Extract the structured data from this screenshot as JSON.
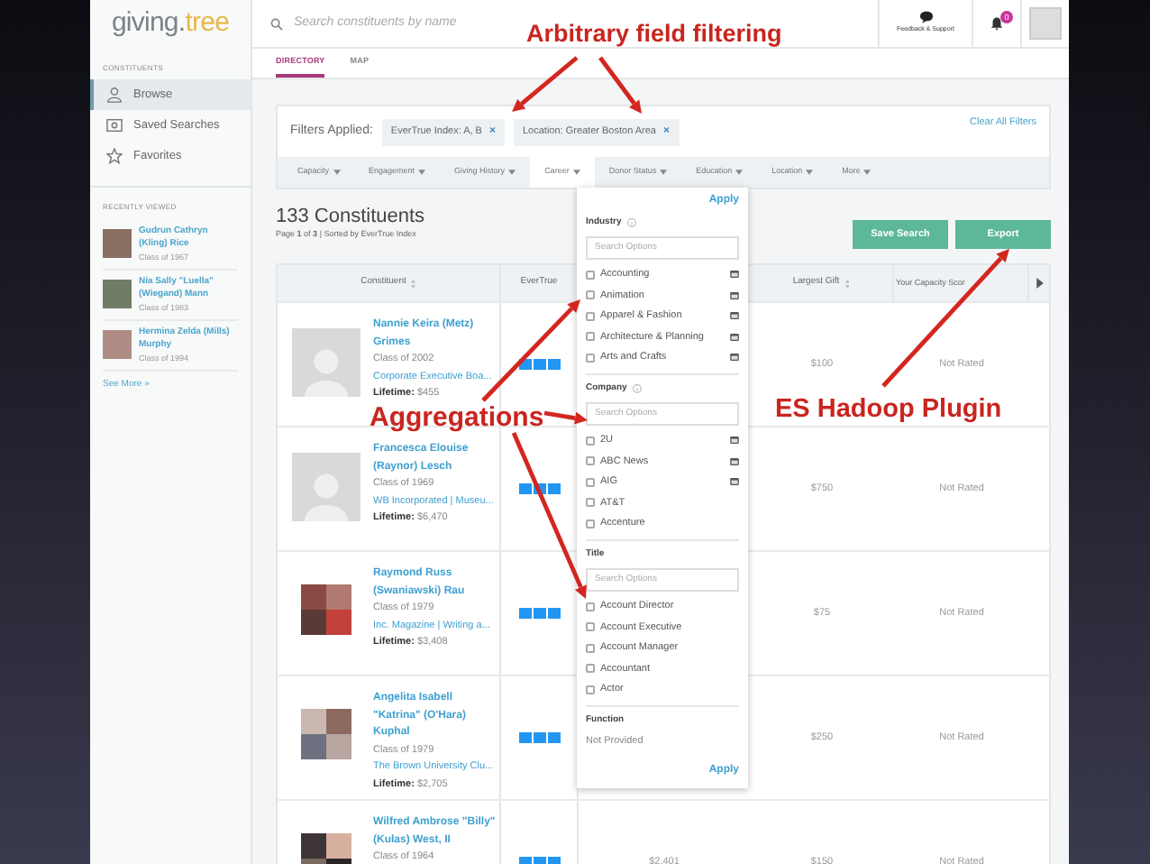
{
  "sidebar": {
    "logo": {
      "primary": "giving.",
      "accent": "tree"
    },
    "section_label": "CONSTITUENTS",
    "nav": [
      {
        "label": "Browse",
        "selected": true
      },
      {
        "label": "Saved Searches",
        "selected": false
      },
      {
        "label": "Favorites",
        "selected": false
      }
    ],
    "recent_label": "RECENTLY VIEWED",
    "recent": [
      {
        "name": "Gudrun Cathryn (Kling) Rice",
        "class_year": "Class of 1967"
      },
      {
        "name": "Nia Sally \"Luella\" (Wiegand) Mann",
        "class_year": "Class of 1983"
      },
      {
        "name": "Hermina Zelda (Mills) Murphy",
        "class_year": "Class of 1994"
      }
    ],
    "see_more": "See More »"
  },
  "header": {
    "search_placeholder": "Search constituents by name",
    "feedback": "Feedback & Support",
    "notifications": "0"
  },
  "tabs": [
    {
      "label": "DIRECTORY",
      "selected": true
    },
    {
      "label": "MAP",
      "selected": false
    }
  ],
  "filters": {
    "label": "Filters Applied:",
    "clear": "Clear All Filters",
    "chips": [
      {
        "label": "EverTrue Index: A, B",
        "remove": "×"
      },
      {
        "label": "Location: Greater Boston Area",
        "remove": "×"
      }
    ],
    "categories": [
      {
        "label": "Capacity",
        "selected": false
      },
      {
        "label": "Engagement",
        "selected": false
      },
      {
        "label": "Giving History",
        "selected": false
      },
      {
        "label": "Career",
        "selected": true
      },
      {
        "label": "Donor Status",
        "selected": false
      },
      {
        "label": "Education",
        "selected": false
      },
      {
        "label": "Location",
        "selected": false
      },
      {
        "label": "More",
        "selected": false
      }
    ]
  },
  "results": {
    "count": "133 Constituents",
    "subtitle": "Page **1** of **3** | Sorted by EverTrue Index",
    "buttons": [
      "Save Search",
      "Export"
    ]
  },
  "table": {
    "columns": [
      {
        "label": "Constituent",
        "sortable": true
      },
      {
        "label": "EverTrue",
        "sortable": false
      },
      {
        "label": "Largest Gift",
        "sortable": true
      },
      {
        "label": "Your Capacity Scor",
        "sortable": false
      }
    ],
    "rows": [
      {
        "kind": "avatar",
        "name": "Nannie Keira (Metz) Grimes",
        "class_year": "Class of 2002",
        "company": "Corporate Executive Boa...",
        "lifetime": "**Lifetime:** $455",
        "largest_gift": "$100",
        "capacity": "Not Rated"
      },
      {
        "kind": "avatar",
        "name": "Francesca Elouise (Raynor) Lesch",
        "class_year": "Class of 1969",
        "company": "WB Incorporated | Museu...",
        "lifetime": "**Lifetime:** $6,470",
        "largest_gift": "$750",
        "capacity": "Not Rated"
      },
      {
        "kind": "photo",
        "name": "Raymond Russ (Swaniawski) Rau",
        "class_year": "Class of 1979",
        "company": "Inc. Magazine | Writing a...",
        "lifetime": "**Lifetime:** $3,408",
        "largest_gift": "$75",
        "capacity": "Not Rated"
      },
      {
        "kind": "photo",
        "name": "Angelita Isabell \"Katrina\" (O'Hara) Kuphal",
        "class_year": "Class of 1979",
        "company": "The Brown University Clu...",
        "lifetime": "**Lifetime:** $2,705",
        "largest_gift": "$250",
        "capacity": "Not Rated"
      },
      {
        "kind": "photo",
        "name": "Wilfred Ambrose \"Billy\" (Kulas) West, II",
        "class_year": "Class of 1964",
        "column_3": "$2,401",
        "largest_gift": "$150",
        "capacity": "Not Rated"
      }
    ]
  },
  "dropdown": {
    "apply_top": "Apply",
    "apply_bottom": "Apply",
    "sections": [
      {
        "kind": "checklist",
        "title": "Industry",
        "info": true,
        "placeholder": "Search Options",
        "options": [
          {
            "label": "Accounting",
            "checked": false,
            "badge": true
          },
          {
            "label": "Animation",
            "checked": false,
            "badge": true
          },
          {
            "label": "Apparel & Fashion",
            "checked": false,
            "badge": true
          },
          {
            "label": "Architecture & Planning",
            "checked": false,
            "badge": true
          },
          {
            "label": "Arts and Crafts",
            "checked": false,
            "badge": true
          }
        ]
      },
      {
        "kind": "checklist",
        "title": "Company",
        "info": true,
        "placeholder": "Search Options",
        "options": [
          {
            "label": "2U",
            "checked": false,
            "badge": true
          },
          {
            "label": "ABC News",
            "checked": false,
            "badge": true
          },
          {
            "label": "AIG",
            "checked": false,
            "badge": true
          },
          {
            "label": "AT&T",
            "checked": false,
            "badge": false
          },
          {
            "label": "Accenture",
            "checked": false,
            "badge": false
          }
        ]
      },
      {
        "kind": "checklist",
        "title": "Title",
        "info": false,
        "placeholder": "Search Options",
        "options": [
          {
            "label": "Account Director",
            "checked": false,
            "badge": false
          },
          {
            "label": "Account Executive",
            "checked": false,
            "badge": false
          },
          {
            "label": "Account Manager",
            "checked": false,
            "badge": false
          },
          {
            "label": "Accountant",
            "checked": false,
            "badge": false
          },
          {
            "label": "Actor",
            "checked": false,
            "badge": false
          }
        ]
      },
      {
        "kind": "text",
        "title": "Function",
        "value": "Not Provided"
      }
    ]
  },
  "annotations": [
    {
      "text": "Arbitrary field filtering"
    },
    {
      "text": "Aggregations"
    },
    {
      "text": "ES Hadoop Plugin"
    }
  ]
}
